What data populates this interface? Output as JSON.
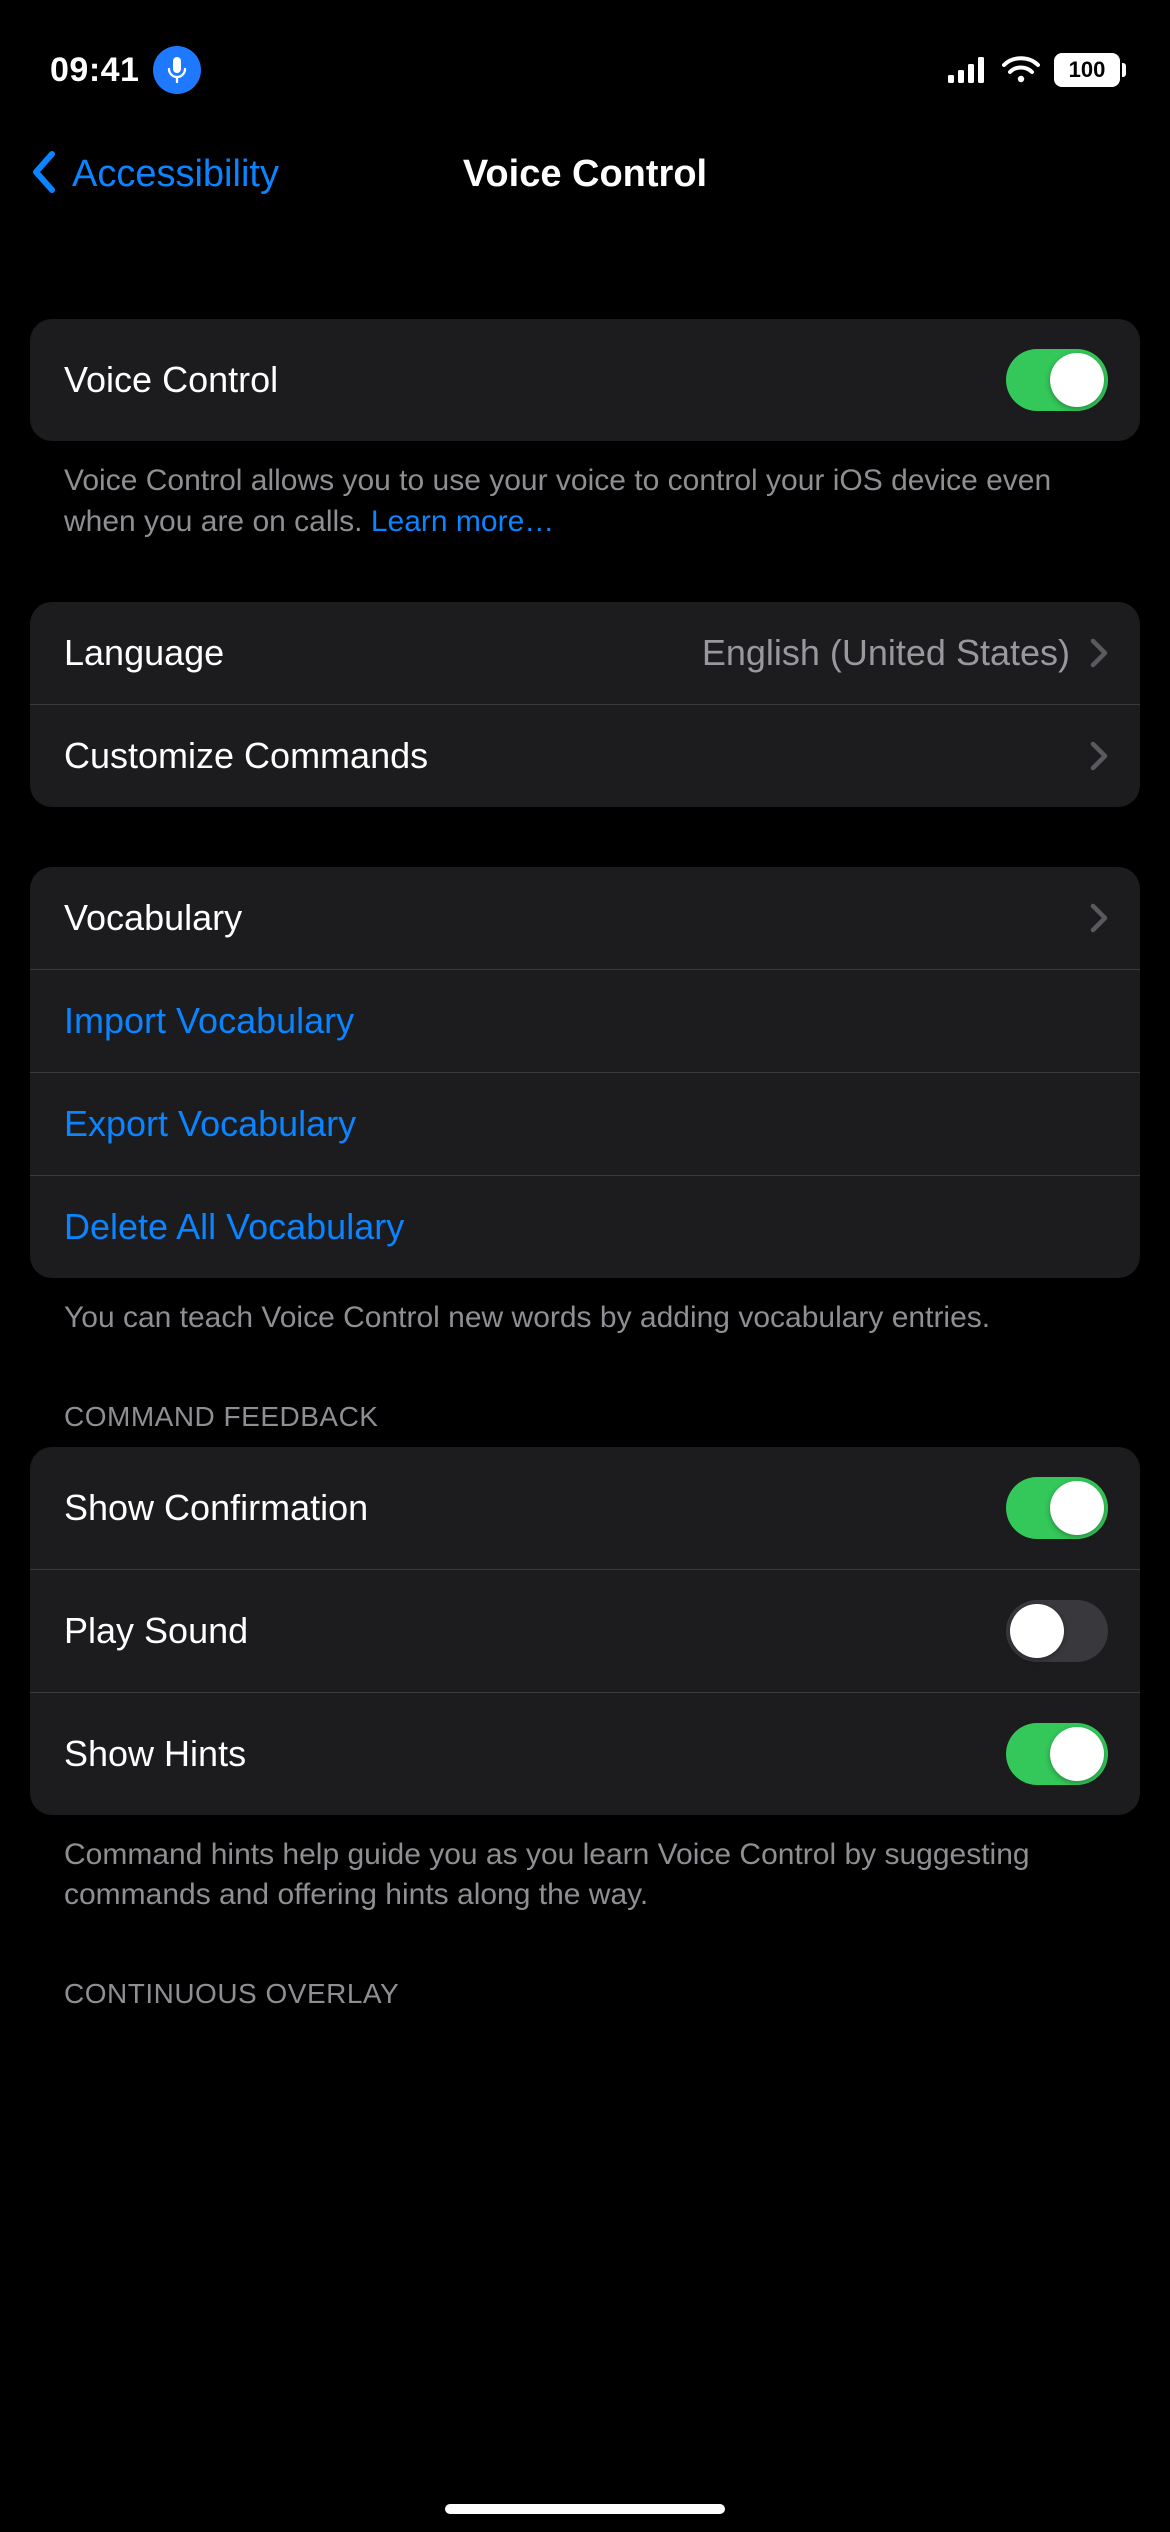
{
  "status": {
    "time": "09:41",
    "mic_icon": "mic-icon",
    "battery": "100"
  },
  "nav": {
    "back_label": "Accessibility",
    "title": "Voice Control"
  },
  "group1": {
    "voice_control_label": "Voice Control",
    "voice_control_on": true,
    "footer_prefix": "Voice Control allows you to use your voice to control your iOS device even when you are on calls. ",
    "footer_link": "Learn more…"
  },
  "group2": {
    "language_label": "Language",
    "language_value": "English (United States)",
    "commands_label": "Customize Commands"
  },
  "group3": {
    "vocab_label": "Vocabulary",
    "import_label": "Import Vocabulary",
    "export_label": "Export Vocabulary",
    "delete_label": "Delete All Vocabulary",
    "footer": "You can teach Voice Control new words by adding vocabulary entries."
  },
  "group4": {
    "header": "COMMAND FEEDBACK",
    "confirm_label": "Show Confirmation",
    "confirm_on": true,
    "sound_label": "Play Sound",
    "sound_on": false,
    "hints_label": "Show Hints",
    "hints_on": true,
    "footer": "Command hints help guide you as you learn Voice Control by suggesting commands and offering hints along the way."
  },
  "group5": {
    "header": "CONTINUOUS OVERLAY"
  }
}
